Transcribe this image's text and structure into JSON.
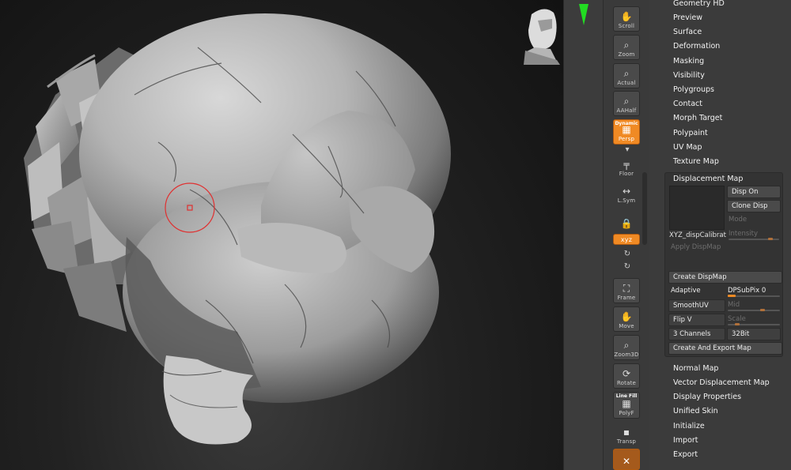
{
  "colors": {
    "accent": "#f08a24",
    "panel": "#3b3b3b",
    "viewport": "#1e1e1e",
    "marker": "#22dd22",
    "brush": "#e03030"
  },
  "toolbar": {
    "buttons": [
      {
        "label": "Scroll",
        "icon": "hand-icon"
      },
      {
        "label": "Zoom",
        "icon": "magnifier-icon"
      },
      {
        "label": "Actual",
        "icon": "actual-icon"
      },
      {
        "label": "AAHalf",
        "icon": "aahalf-icon"
      },
      {
        "label": "Persp",
        "top_label": "Dynamic",
        "icon": "persp-icon",
        "active": true
      },
      {
        "label": "Floor",
        "icon": "floor-icon"
      },
      {
        "label": "L.Sym",
        "icon": "lsym-icon"
      },
      {
        "label": "",
        "icon": "lock-icon"
      },
      {
        "label": "xyz",
        "icon": "xyz-icon",
        "active": true
      },
      {
        "label": "Frame",
        "icon": "frame-icon"
      },
      {
        "label": "Move",
        "icon": "move-icon"
      },
      {
        "label": "Zoom3D",
        "icon": "zoom3d-icon"
      },
      {
        "label": "Rotate",
        "icon": "rotate-icon"
      },
      {
        "label": "PolyF",
        "top_label": "Line Fill",
        "icon": "polyf-icon"
      },
      {
        "label": "Transp",
        "icon": "transp-icon"
      }
    ]
  },
  "menu": {
    "items_top": [
      "Geometry HD",
      "Preview",
      "Surface",
      "Deformation",
      "Masking",
      "Visibility",
      "Polygroups",
      "Contact",
      "Morph Target",
      "Polypaint",
      "UV Map",
      "Texture Map"
    ],
    "items_bottom": [
      "Normal Map",
      "Vector Displacement Map",
      "Display Properties",
      "Unified Skin",
      "Initialize",
      "Import",
      "Export"
    ]
  },
  "displacement": {
    "header": "Displacement Map",
    "disp_on": "Disp On",
    "clone_disp": "Clone Disp",
    "mode": "Mode",
    "intensity": "Intensity",
    "thumb_label": "XYZ_dispCalibrat",
    "apply": "Apply DispMap",
    "create": "Create DispMap",
    "adaptive": "Adaptive",
    "dpsubpix": "DPSubPix 0",
    "smoothuv": "SmoothUV",
    "mid": "Mid",
    "flipv": "Flip V",
    "scale": "Scale",
    "channels": "3 Channels",
    "bits": "32Bit",
    "export": "Create And Export Map"
  }
}
